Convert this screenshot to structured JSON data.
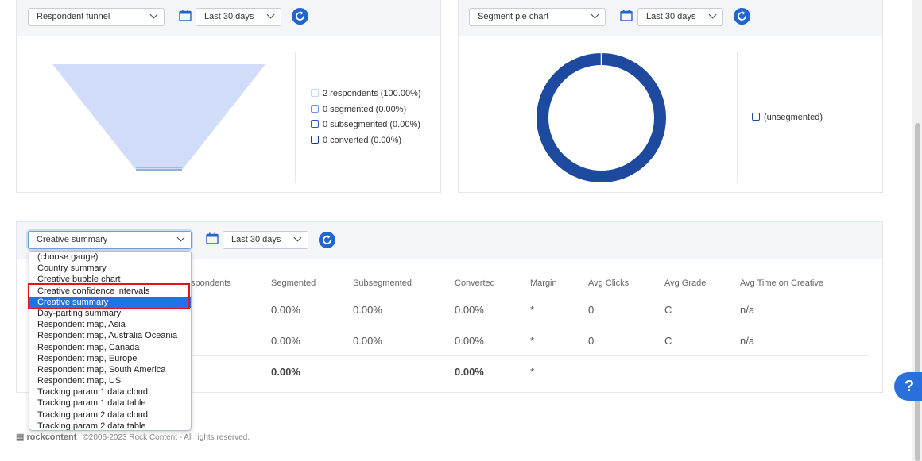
{
  "widgets": [
    {
      "gauge": "Respondent funnel",
      "range": "Last 30 days"
    },
    {
      "gauge": "Segment pie chart",
      "range": "Last 30 days"
    },
    {
      "gauge": "Creative summary",
      "range": "Last 30 days"
    }
  ],
  "funnel_legend": [
    {
      "label": "2 respondents (100.00%)",
      "color": "#c6d6f5"
    },
    {
      "label": "0 segmented (0.00%)",
      "color": "#6f93e0"
    },
    {
      "label": "0 subsegmented (0.00%)",
      "color": "#2f58b0"
    },
    {
      "label": "0 converted (0.00%)",
      "color": "#173e8c"
    }
  ],
  "pie_legend": [
    {
      "label": "(unsegmented)",
      "color": "#1d4a9e"
    }
  ],
  "table": {
    "headers": [
      "Respondents",
      "Segmented",
      "Subsegmented",
      "Converted",
      "Margin",
      "Avg Clicks",
      "Avg Grade",
      "Avg Time on Creative"
    ],
    "header_visible_prefix": "spondents",
    "rows": [
      [
        "0.00%",
        "0.00%",
        "0.00%",
        "*",
        "0",
        "C",
        "n/a"
      ],
      [
        "0.00%",
        "0.00%",
        "0.00%",
        "*",
        "0",
        "C",
        "n/a"
      ]
    ],
    "total": [
      "0.00%",
      "0.00%",
      "*"
    ]
  },
  "dropdown": {
    "options": [
      "(choose gauge)",
      "Country summary",
      "Creative bubble chart",
      "Creative confidence intervals",
      "Creative summary",
      "Day-parting summary",
      "Respondent map, Asia",
      "Respondent map, Australia Oceania",
      "Respondent map, Canada",
      "Respondent map, Europe",
      "Respondent map, South America",
      "Respondent map, US",
      "Tracking param 1 data cloud",
      "Tracking param 1 data table",
      "Tracking param 2 data cloud",
      "Tracking param 2 data table"
    ],
    "selected_index": 4
  },
  "footer": {
    "logo": "rockcontent",
    "copyright": "©2006-2023 Rock Content - All rights reserved."
  },
  "help_label": "?",
  "colors": {
    "accent": "#2266cc",
    "selected": "#1e73e8",
    "funnel_fill": "#d1ddf8",
    "pie_ring": "#1d4a9e",
    "highlight": "#e0141e"
  }
}
